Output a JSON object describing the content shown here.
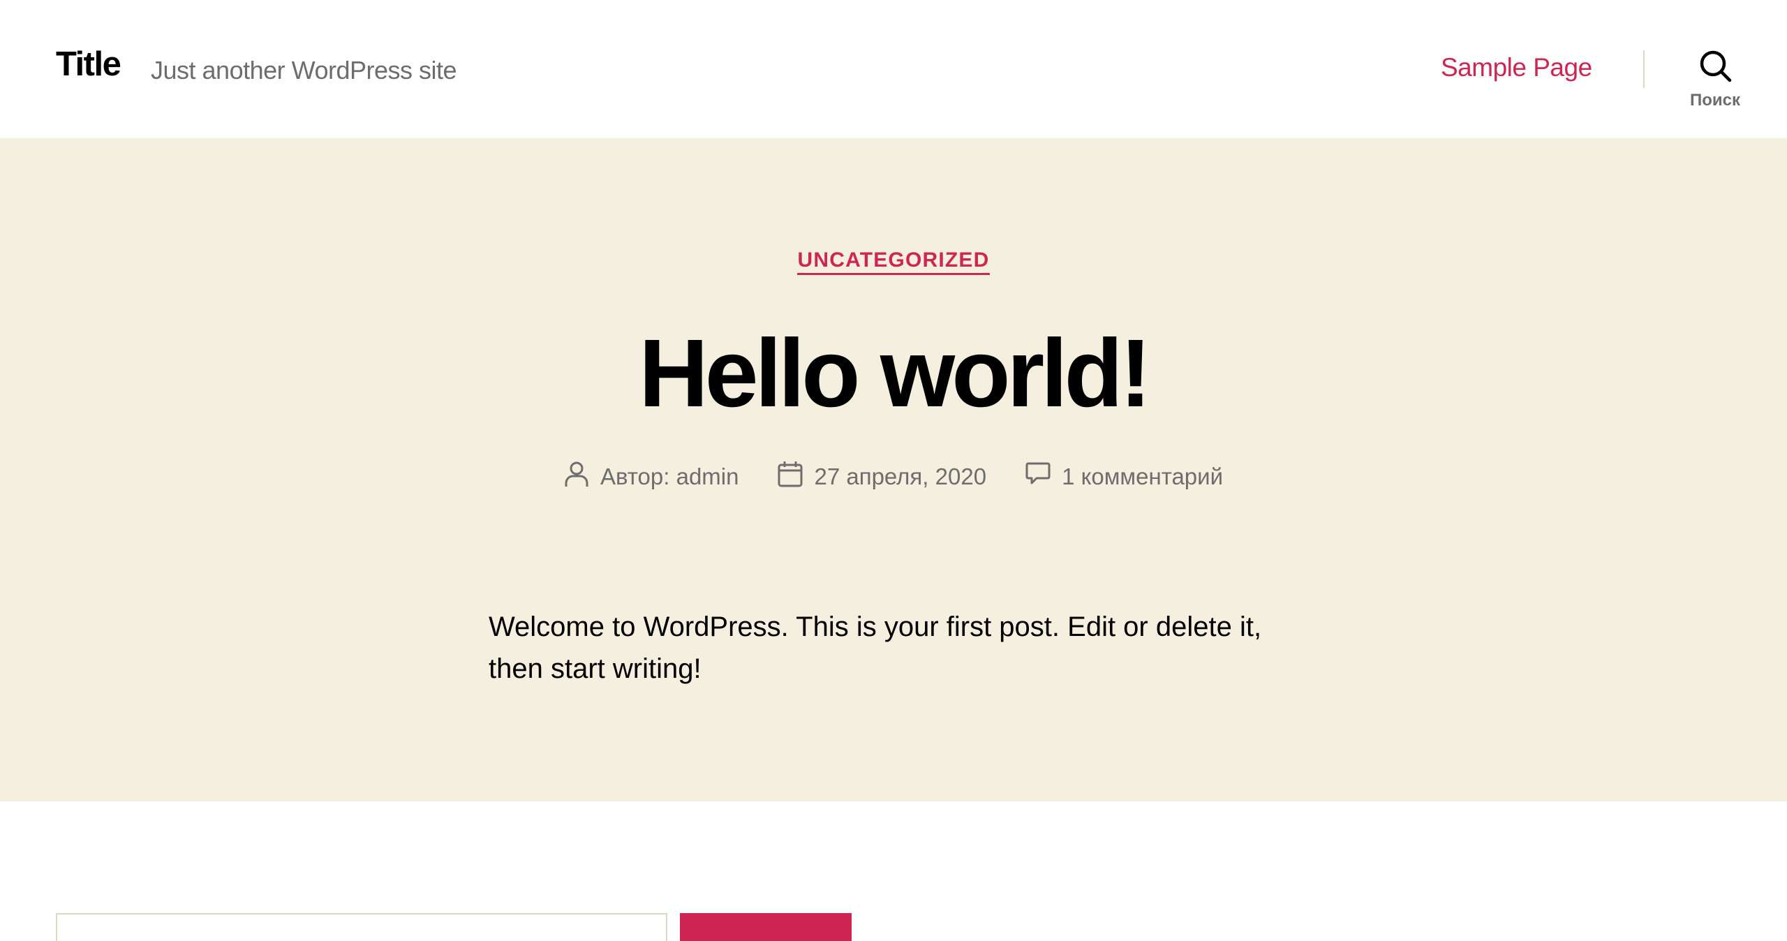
{
  "header": {
    "site_title": "Title",
    "tagline": "Just another WordPress site",
    "nav": [
      {
        "label": "Sample Page"
      }
    ],
    "search_label": "Поиск"
  },
  "post": {
    "category": "UNCATEGORIZED",
    "title": "Hello world!",
    "meta": {
      "author": "Автор: admin",
      "date": "27 апреля, 2020",
      "comments": "1 комментарий"
    },
    "content": "Welcome to WordPress. This is your first post. Edit or delete it, then start writing!"
  },
  "colors": {
    "accent": "#cd2653",
    "hero_background": "#f5efe0",
    "secondary_text": "#6d6d6d",
    "border": "#dcd7ca"
  },
  "icons": [
    "search-icon",
    "user-icon",
    "calendar-icon",
    "comment-icon"
  ]
}
